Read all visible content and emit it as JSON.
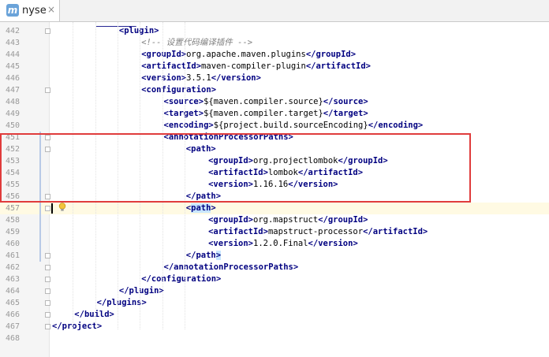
{
  "tab": {
    "icon": "maven-icon",
    "title": "nyse",
    "close": "×"
  },
  "lines": [
    {
      "n": "442",
      "indent": 3,
      "parts": [
        [
          "tag",
          "<plugin>"
        ]
      ]
    },
    {
      "n": "443",
      "indent": 4,
      "parts": [
        [
          "cmt",
          "<!-- 设置代码编译插件 -->"
        ]
      ]
    },
    {
      "n": "444",
      "indent": 4,
      "parts": [
        [
          "tag",
          "<groupId>"
        ],
        [
          "txt",
          "org.apache.maven.plugins"
        ],
        [
          "tag",
          "</groupId>"
        ]
      ]
    },
    {
      "n": "445",
      "indent": 4,
      "parts": [
        [
          "tag",
          "<artifactId>"
        ],
        [
          "txt",
          "maven-compiler-plugin"
        ],
        [
          "tag",
          "</artifactId>"
        ]
      ]
    },
    {
      "n": "446",
      "indent": 4,
      "parts": [
        [
          "tag",
          "<version>"
        ],
        [
          "txt",
          "3.5.1"
        ],
        [
          "tag",
          "</version>"
        ]
      ]
    },
    {
      "n": "447",
      "indent": 4,
      "parts": [
        [
          "tag",
          "<configuration>"
        ]
      ]
    },
    {
      "n": "448",
      "indent": 5,
      "parts": [
        [
          "tag",
          "<source>"
        ],
        [
          "txt",
          "${maven.compiler.source}"
        ],
        [
          "tag",
          "</source>"
        ]
      ]
    },
    {
      "n": "449",
      "indent": 5,
      "parts": [
        [
          "tag",
          "<target>"
        ],
        [
          "txt",
          "${maven.compiler.target}"
        ],
        [
          "tag",
          "</target>"
        ]
      ]
    },
    {
      "n": "450",
      "indent": 5,
      "parts": [
        [
          "tag",
          "<encoding>"
        ],
        [
          "txt",
          "${project.build.sourceEncoding}"
        ],
        [
          "tag",
          "</encoding>"
        ]
      ]
    },
    {
      "n": "451",
      "indent": 5,
      "parts": [
        [
          "tag",
          "<annotationProcessorPaths>"
        ]
      ]
    },
    {
      "n": "452",
      "indent": 6,
      "parts": [
        [
          "tag",
          "<path>"
        ]
      ]
    },
    {
      "n": "453",
      "indent": 7,
      "parts": [
        [
          "tag",
          "<groupId>"
        ],
        [
          "txt",
          "org.projectlombok"
        ],
        [
          "tag",
          "</groupId>"
        ]
      ]
    },
    {
      "n": "454",
      "indent": 7,
      "parts": [
        [
          "tag",
          "<artifactId>"
        ],
        [
          "txt",
          "lombok"
        ],
        [
          "tag",
          "</artifactId>"
        ]
      ]
    },
    {
      "n": "455",
      "indent": 7,
      "parts": [
        [
          "tag",
          "<version>"
        ],
        [
          "txt",
          "1.16.16"
        ],
        [
          "tag",
          "</version>"
        ]
      ]
    },
    {
      "n": "456",
      "indent": 6,
      "parts": [
        [
          "tag",
          "</path>"
        ]
      ]
    },
    {
      "n": "457",
      "indent": 6,
      "parts": [
        [
          "tag",
          "<"
        ],
        [
          "tagb",
          "path"
        ],
        [
          "tag",
          ">"
        ]
      ]
    },
    {
      "n": "458",
      "indent": 7,
      "parts": [
        [
          "tag",
          "<groupId>"
        ],
        [
          "txt",
          "org.mapstruct"
        ],
        [
          "tag",
          "</groupId>"
        ]
      ]
    },
    {
      "n": "459",
      "indent": 7,
      "parts": [
        [
          "tag",
          "<artifactId>"
        ],
        [
          "txt",
          "mapstruct-processor"
        ],
        [
          "tag",
          "</artifactId>"
        ]
      ]
    },
    {
      "n": "460",
      "indent": 7,
      "parts": [
        [
          "tag",
          "<version>"
        ],
        [
          "txt",
          "1.2.0.Final"
        ],
        [
          "tag",
          "</version>"
        ]
      ]
    },
    {
      "n": "461",
      "indent": 6,
      "parts": [
        [
          "tag",
          "</path"
        ],
        [
          "tagb",
          ">"
        ]
      ]
    },
    {
      "n": "462",
      "indent": 5,
      "parts": [
        [
          "tag",
          "</annotationProcessorPaths>"
        ]
      ]
    },
    {
      "n": "463",
      "indent": 4,
      "parts": [
        [
          "tag",
          "</configuration>"
        ]
      ]
    },
    {
      "n": "464",
      "indent": 3,
      "parts": [
        [
          "tag",
          "</plugin>"
        ]
      ]
    },
    {
      "n": "465",
      "indent": 2,
      "parts": [
        [
          "tag",
          "</plugins>"
        ]
      ]
    },
    {
      "n": "466",
      "indent": 1,
      "parts": [
        [
          "tag",
          "</build>"
        ]
      ]
    },
    {
      "n": "467",
      "indent": 0,
      "parts": [
        [
          "tag",
          "</project>"
        ]
      ]
    },
    {
      "n": "468",
      "indent": 0,
      "parts": []
    }
  ],
  "highlight_color": "#e03c3c",
  "current_line": "457"
}
